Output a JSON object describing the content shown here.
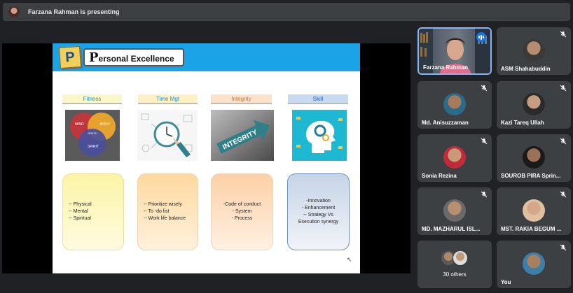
{
  "presenting_banner": "Farzana Rahman is presenting",
  "slide": {
    "badge_letter": "P",
    "title_first_letter": "P",
    "title_rest": "ersonal Excellence",
    "columns": [
      {
        "label": "Fitness",
        "card_text": "-- Physical\n-- Mental\n-- Spiritual",
        "venn": [
          "MIND",
          "BODY",
          "HEALTH",
          "SPIRIT"
        ]
      },
      {
        "label": "Time Mgt",
        "card_text": "-- Prioritize wisely\n-- To -do list\n-- Work life balance"
      },
      {
        "label": "Integrity",
        "card_text": "-Code of conduct\n- System\n- Process",
        "image_word": "INTEGRITY"
      },
      {
        "label": "Skill",
        "card_text": "-Innovation\n- Enhancement\n-- Strategy Vs\nExecution synergy"
      }
    ]
  },
  "participants": [
    {
      "name": "Farzana Rahman",
      "state": "speaking"
    },
    {
      "name": "ASM Shahabuddin",
      "state": "muted"
    },
    {
      "name": "Md. Anisuzzaman",
      "state": "muted"
    },
    {
      "name": "Kazi Tareq Ullah",
      "state": "muted"
    },
    {
      "name": "Sonia Rezina",
      "state": "muted"
    },
    {
      "name": "SOUROB PIRA Sprin...",
      "state": "muted"
    },
    {
      "name": "MD. MAZHARUL ISL...",
      "state": "muted"
    },
    {
      "name": "MST. RAKIA BEGUM ...",
      "state": "muted"
    },
    {
      "name": "30 others",
      "state": "group"
    },
    {
      "name": "You",
      "state": "muted"
    }
  ],
  "colors": {
    "accent_blue": "#1a73e8",
    "header_blue": "#1aa3e6",
    "tile_bg": "#3c4043",
    "page_bg": "#202124"
  },
  "icons": [
    "mic-off-icon",
    "speaking-indicator-icon",
    "cursor-icon"
  ]
}
